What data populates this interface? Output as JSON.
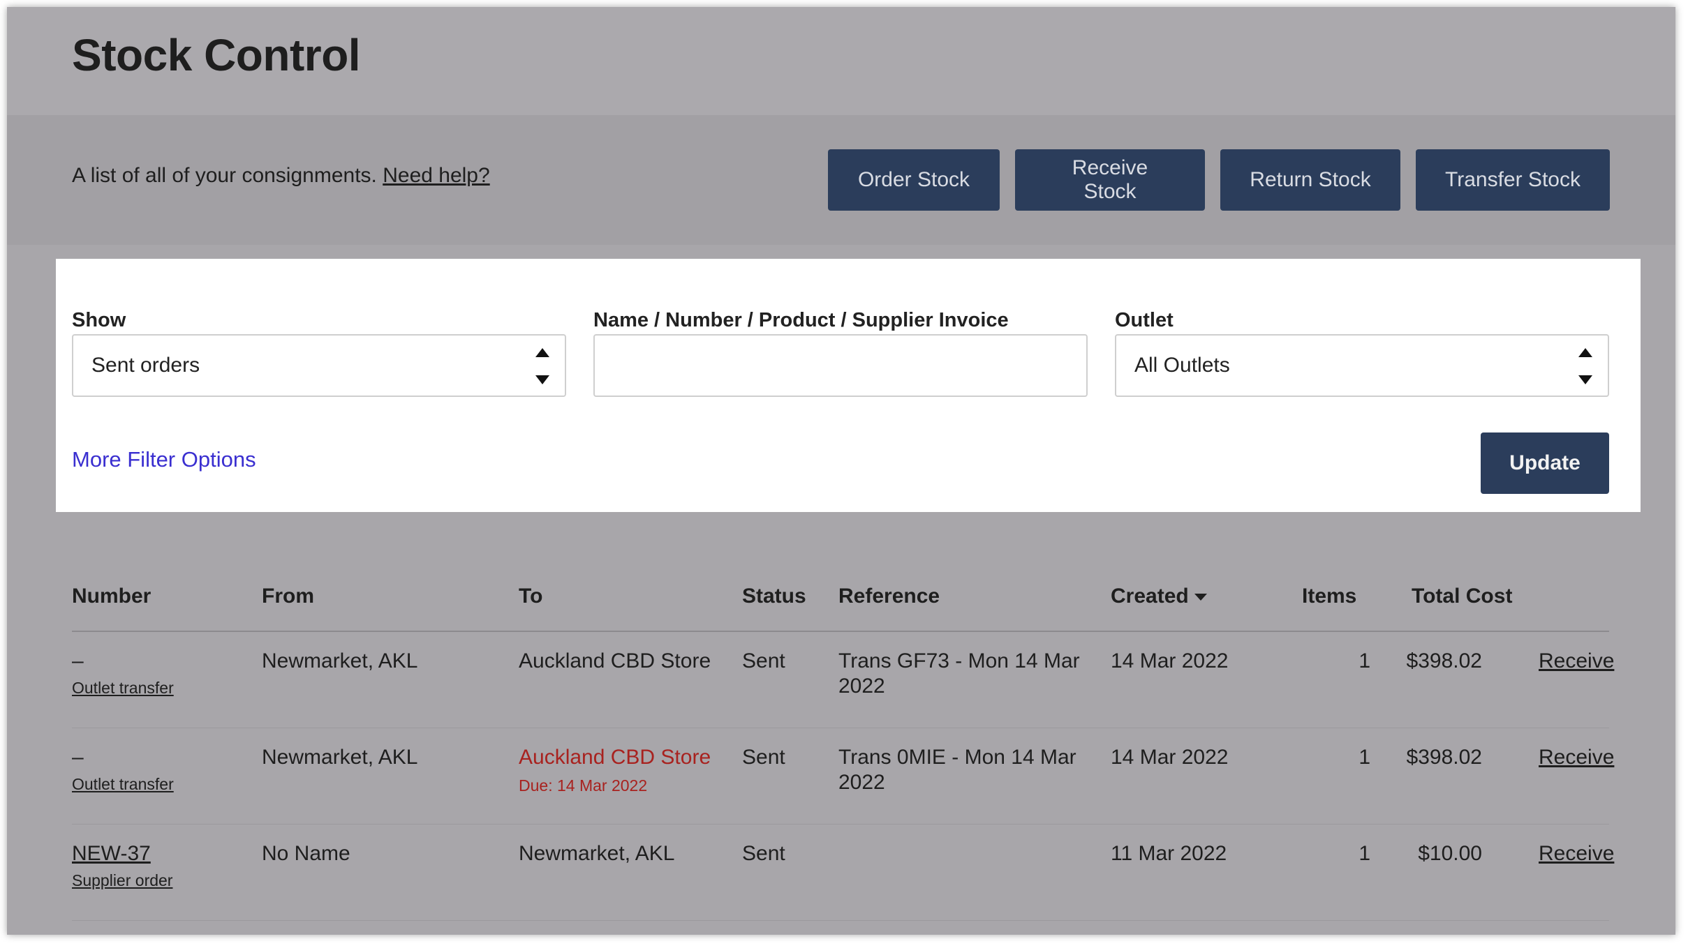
{
  "header": {
    "title": "Stock Control"
  },
  "subheader": {
    "intro": "A list of all of your consignments.",
    "help_link": "Need help?",
    "buttons": {
      "order": "Order Stock",
      "receive": "Receive Stock",
      "return": "Return Stock",
      "transfer": "Transfer Stock"
    }
  },
  "filters": {
    "show_label": "Show",
    "show_value": "Sent orders",
    "search_label": "Name / Number / Product / Supplier Invoice",
    "search_value": "",
    "outlet_label": "Outlet",
    "outlet_value": "All Outlets",
    "more_options": "More Filter Options",
    "update": "Update"
  },
  "table": {
    "columns": [
      "Number",
      "From",
      "To",
      "Status",
      "Reference",
      "Created",
      "Items",
      "Total Cost"
    ],
    "rows": [
      {
        "number": "–",
        "type": "Outlet transfer",
        "from": "Newmarket, AKL",
        "to": "Auckland CBD Store",
        "due": "",
        "status": "Sent",
        "reference": "Trans GF73 - Mon 14 Mar 2022",
        "created": "14 Mar 2022",
        "items": "1",
        "total": "$398.02",
        "action": "Receive"
      },
      {
        "number": "–",
        "type": "Outlet transfer",
        "from": "Newmarket, AKL",
        "to": "Auckland CBD Store",
        "due": "Due: 14 Mar 2022",
        "status": "Sent",
        "reference": "Trans 0MIE - Mon 14 Mar 2022",
        "created": "14 Mar 2022",
        "items": "1",
        "total": "$398.02",
        "action": "Receive"
      },
      {
        "number": "NEW-37",
        "type": "Supplier order",
        "from": "No Name",
        "to": "Newmarket, AKL",
        "due": "",
        "status": "Sent",
        "reference": "",
        "created": "11 Mar 2022",
        "items": "1",
        "total": "$10.00",
        "action": "Receive"
      }
    ]
  },
  "colors": {
    "button_bg": "#2b3d5b",
    "overdue_red": "#a8221f",
    "link_blue": "#3a2fd0"
  }
}
